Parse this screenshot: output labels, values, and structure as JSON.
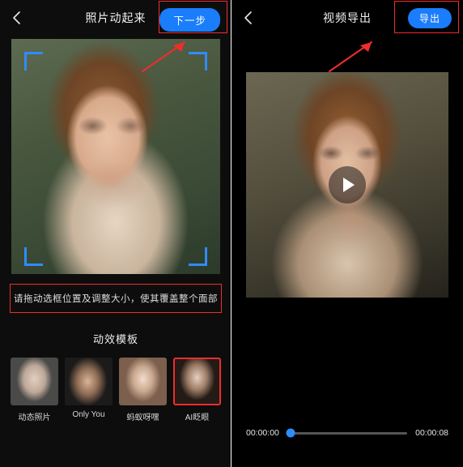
{
  "left": {
    "header": {
      "title": "照片动起来",
      "next_label": "下一步",
      "back_icon": "chevron-left-icon"
    },
    "hint": "请拖动选框位置及调整大小，使其覆盖整个面部",
    "templates": {
      "section_title": "动效模板",
      "items": [
        {
          "label": "动态照片",
          "selected": false
        },
        {
          "label": "Only You",
          "selected": false
        },
        {
          "label": "蚂蚁呀嘿",
          "selected": false
        },
        {
          "label": "AI眨眼",
          "selected": true
        }
      ]
    },
    "crop": {
      "corner_color": "#2f8cff"
    }
  },
  "right": {
    "header": {
      "title": "视频导出",
      "export_label": "导出",
      "back_icon": "chevron-left-icon"
    },
    "player": {
      "play_icon": "play-icon",
      "current_time": "00:00:00",
      "total_time": "00:00:08",
      "progress_percent": 3
    }
  },
  "annotations": {
    "accent_red": "#ef2d2d",
    "accent_blue": "#1a7dfb"
  }
}
